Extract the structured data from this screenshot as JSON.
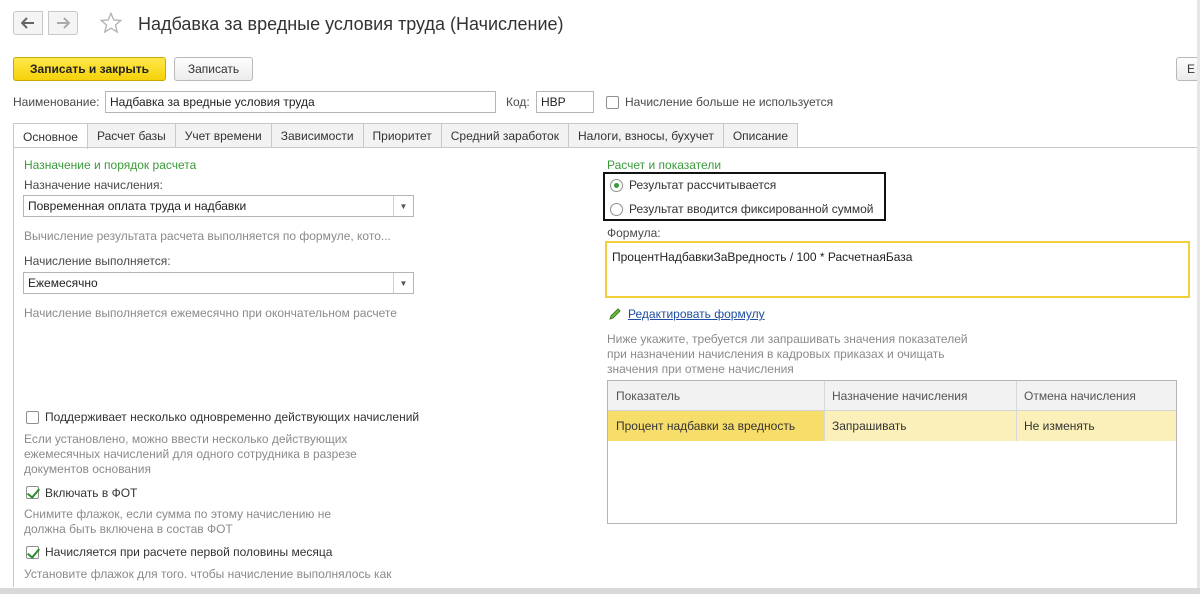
{
  "window": {
    "title": "Надбавка за вредные условия труда (Начисление)"
  },
  "toolbar": {
    "save_close_label": "Записать и закрыть",
    "save_label": "Записать",
    "edge_label": "Е"
  },
  "header": {
    "name_label": "Наименование:",
    "name_value": "Надбавка за вредные условия труда",
    "code_label": "Код:",
    "code_value": "НВР",
    "not_used_label": "Начисление больше не используется",
    "not_used_checked": false
  },
  "tabs": [
    {
      "label": "Основное",
      "active": true
    },
    {
      "label": "Расчет базы",
      "active": false
    },
    {
      "label": "Учет времени",
      "active": false
    },
    {
      "label": "Зависимости",
      "active": false
    },
    {
      "label": "Приоритет",
      "active": false
    },
    {
      "label": "Средний заработок",
      "active": false
    },
    {
      "label": "Налоги, взносы, бухучет",
      "active": false
    },
    {
      "label": "Описание",
      "active": false
    }
  ],
  "left": {
    "section_title": "Назначение и порядок расчета",
    "purpose_label": "Назначение начисления:",
    "purpose_value": "Повременная оплата труда и надбавки",
    "purpose_hint": "Вычисление результата расчета выполняется по формуле, кото...",
    "frequency_label": "Начисление выполняется:",
    "frequency_value": "Ежемесячно",
    "frequency_hint": "Начисление выполняется ежемесячно при окончательном расчете",
    "multi_label": "Поддерживает несколько одновременно действующих начислений",
    "multi_checked": false,
    "multi_hint": "Если установлено, можно ввести несколько действующих ежемесячных начислений для одного сотрудника в разрезе документов основания",
    "fot_label": "Включать в ФОТ",
    "fot_checked": true,
    "fot_hint": "Снимите флажок, если сумма по этому начислению не должна быть включена в состав ФОТ",
    "first_half_label": "Начисляется при расчете первой половины месяца",
    "first_half_checked": true,
    "first_half_hint": "Установите флажок для того. чтобы начисление выполнялось как"
  },
  "right": {
    "section_title": "Расчет и показатели",
    "radio_calculated": "Результат рассчитывается",
    "radio_fixed": "Результат вводится фиксированной суммой",
    "selected_radio": "calculated",
    "formula_label": "Формула:",
    "formula_value": "ПроцентНадбавкиЗаВредность / 100 * РасчетнаяБаза",
    "edit_formula_link": "Редактировать формулу",
    "indicators_hint": "Ниже укажите, требуется ли запрашивать значения показателей при назначении начисления в кадровых приказах и очищать значения при отмене начисления",
    "table": {
      "columns": [
        "Показатель",
        "Назначение начисления",
        "Отмена начисления"
      ],
      "rows": [
        [
          "Процент надбавки за вредность",
          "Запрашивать",
          "Не изменять"
        ]
      ]
    }
  },
  "icons": {
    "back": "arrow-left-icon",
    "forward": "arrow-right-icon",
    "favorite": "star-icon",
    "edit": "pencil-icon"
  },
  "colors": {
    "primary_button": "#f5d20a",
    "section_title": "#3a9a3a",
    "formula_border": "#f0cf3a",
    "selected_row": "#fbf0b9",
    "link": "#1f4ea1"
  }
}
